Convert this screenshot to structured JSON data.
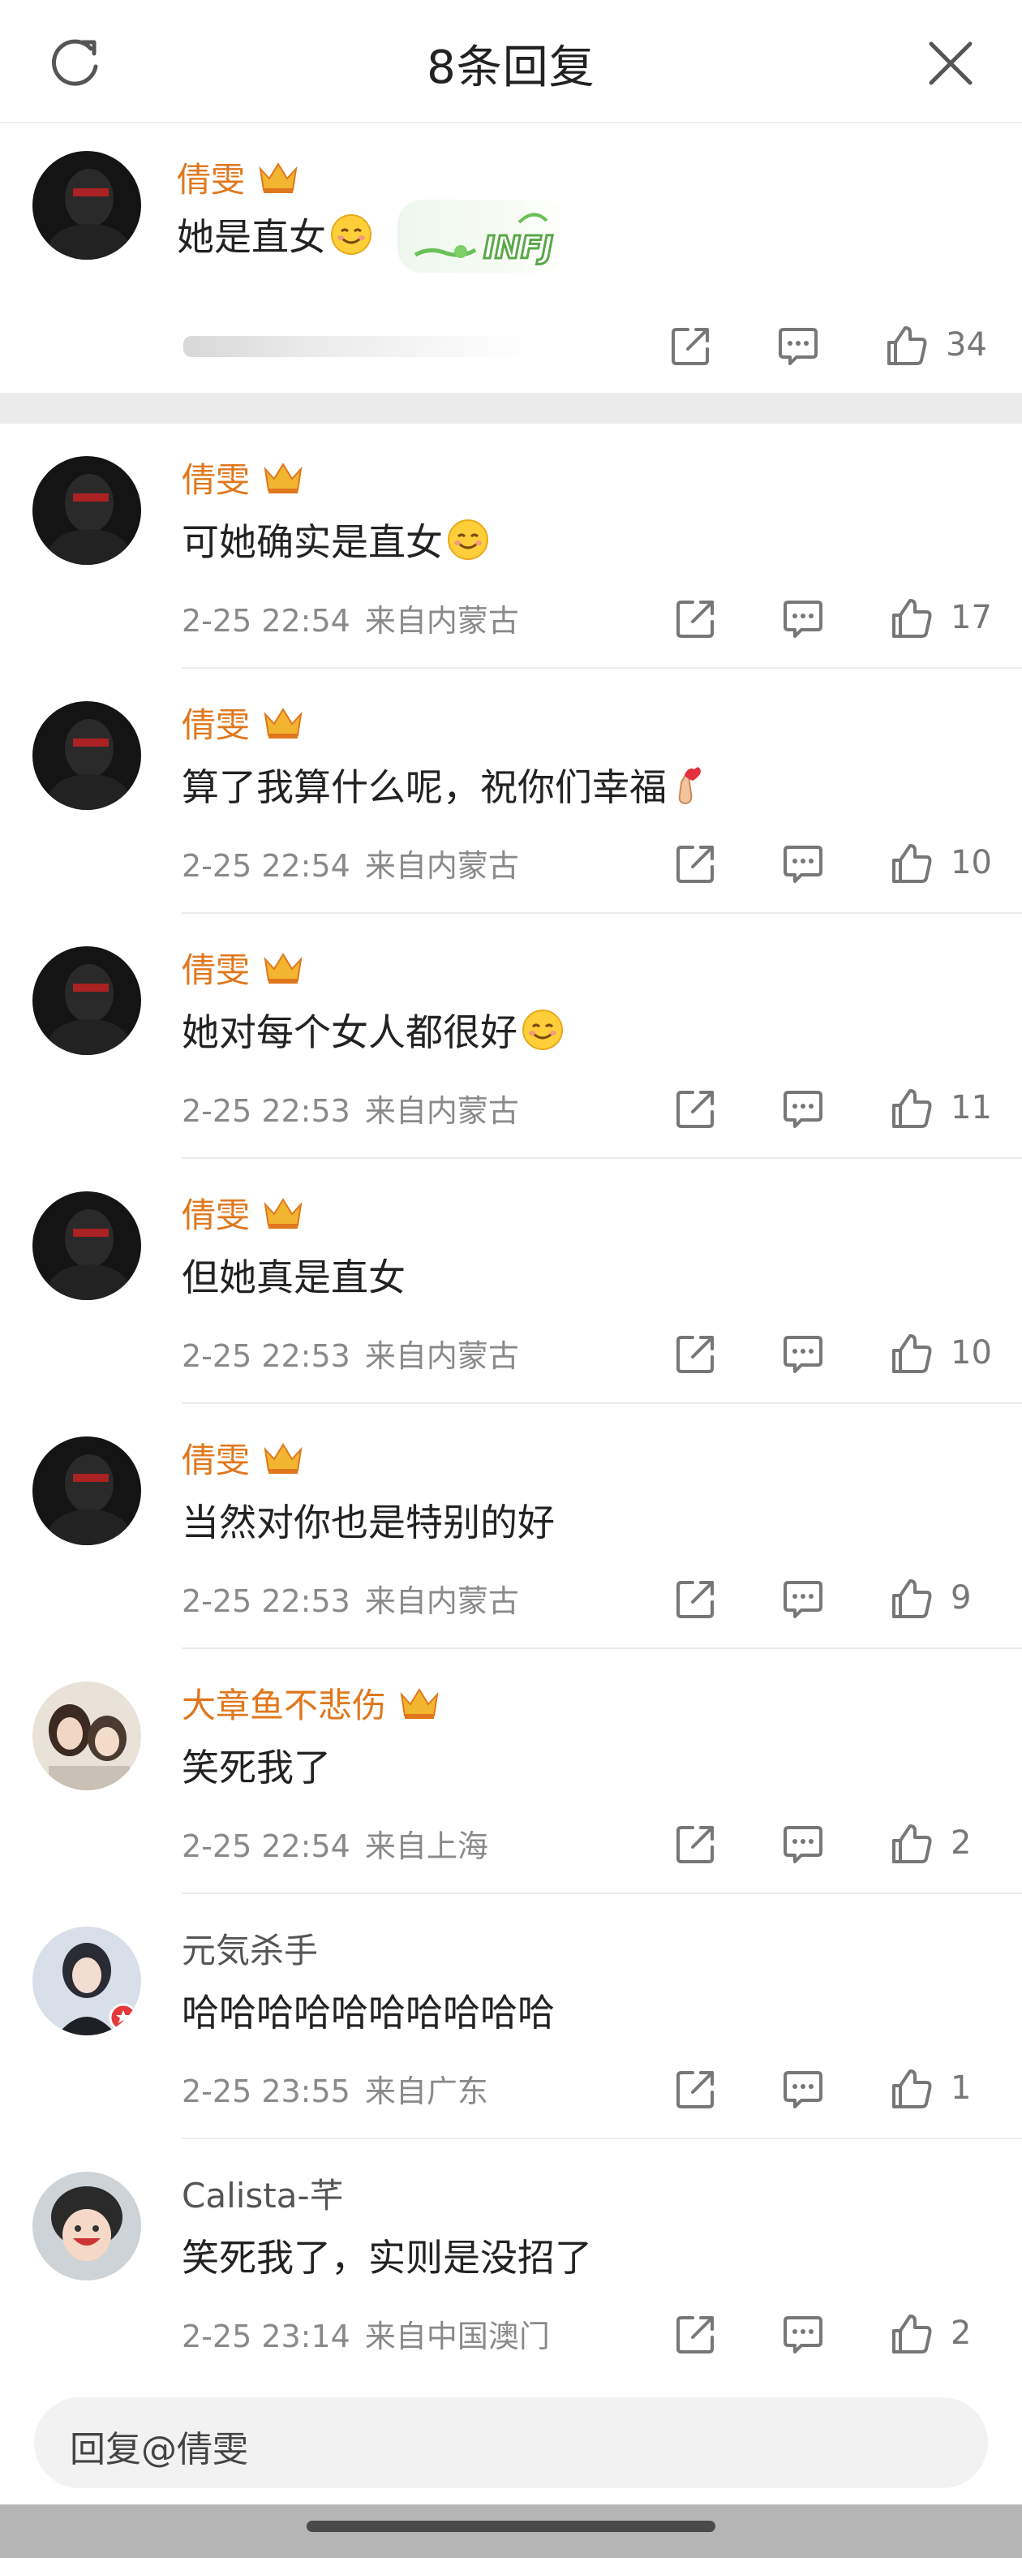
{
  "header": {
    "title": "8条回复"
  },
  "main_comment": {
    "user": "倩雯",
    "text": "她是直女",
    "sticker": "INFJ",
    "likes": "34"
  },
  "replies": [
    {
      "user": "倩雯",
      "text": "可她确实是直女",
      "time": "2-25 22:54",
      "location": "来自内蒙古",
      "likes": "17"
    },
    {
      "user": "倩雯",
      "text": "算了我算什么呢，祝你们幸福",
      "time": "2-25 22:54",
      "location": "来自内蒙古",
      "likes": "10"
    },
    {
      "user": "倩雯",
      "text": "她对每个女人都很好",
      "time": "2-25 22:53",
      "location": "来自内蒙古",
      "likes": "11"
    },
    {
      "user": "倩雯",
      "text": "但她真是直女",
      "time": "2-25 22:53",
      "location": "来自内蒙古",
      "likes": "10"
    },
    {
      "user": "倩雯",
      "text": "当然对你也是特别的好",
      "time": "2-25 22:53",
      "location": "来自内蒙古",
      "likes": "9"
    },
    {
      "user": "大章鱼不悲伤",
      "text": "笑死我了",
      "time": "2-25 22:54",
      "location": "来自上海",
      "likes": "2"
    },
    {
      "user": "元気杀手",
      "text": "哈哈哈哈哈哈哈哈哈哈",
      "time": "2-25 23:55",
      "location": "来自广东",
      "likes": "1"
    },
    {
      "user": "Calista-芊",
      "text": "笑死我了，实则是没招了",
      "time": "2-25 23:14",
      "location": "来自中国澳门",
      "likes": "2"
    }
  ],
  "input": {
    "placeholder": "回复@倩雯"
  },
  "colors": {
    "username": "#e0771d",
    "username_plain": "#555555",
    "meta": "#8a8a8a",
    "divider": "#ececec"
  },
  "icons": [
    "refresh-icon",
    "close-icon",
    "crown-icon",
    "share-icon",
    "comment-icon",
    "like-icon",
    "smile-emoji",
    "finger-heart-emoji"
  ]
}
